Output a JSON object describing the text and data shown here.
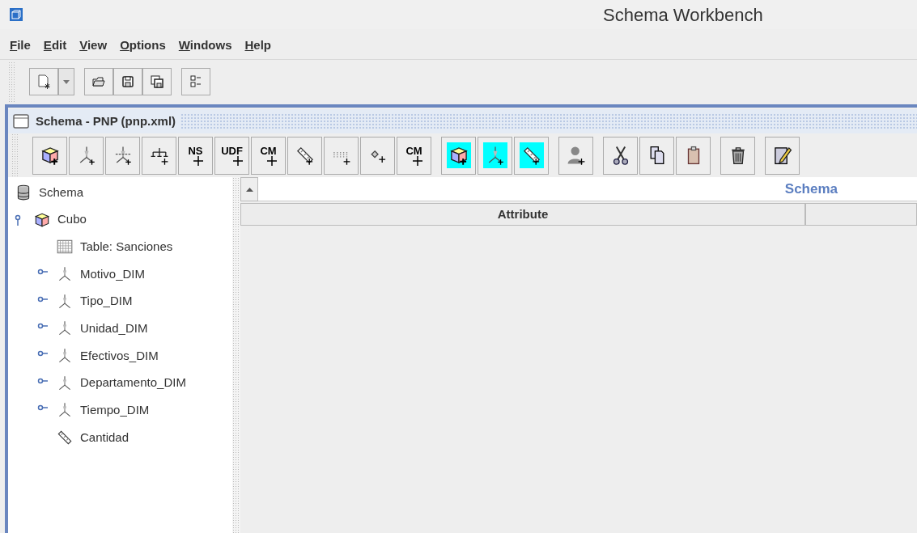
{
  "window": {
    "title": "Schema Workbench"
  },
  "menu": [
    {
      "label": "File"
    },
    {
      "label": "Edit"
    },
    {
      "label": "View"
    },
    {
      "label": "Options"
    },
    {
      "label": "Windows"
    },
    {
      "label": "Help"
    }
  ],
  "main_toolbar": [
    [
      {
        "kind": "new"
      },
      {
        "kind": "dropdown"
      }
    ],
    [
      {
        "kind": "open"
      },
      {
        "kind": "save"
      },
      {
        "kind": "save-all"
      }
    ],
    [
      {
        "kind": "prefs"
      }
    ]
  ],
  "schema_window": {
    "title": "Schema - PNP (pnp.xml)",
    "tool_groups": [
      [
        {
          "kind": "cube",
          "highlighted": false
        },
        {
          "kind": "dimension",
          "highlighted": false
        },
        {
          "kind": "dimension-usage",
          "highlighted": false
        },
        {
          "kind": "hierarchy",
          "highlighted": false
        },
        {
          "kind": "text",
          "label": "NS",
          "highlighted": false
        },
        {
          "kind": "text",
          "label": "UDF",
          "highlighted": false
        },
        {
          "kind": "text",
          "label": "CM",
          "highlighted": false
        },
        {
          "kind": "measure",
          "highlighted": false
        },
        {
          "kind": "levels",
          "highlighted": false
        },
        {
          "kind": "property",
          "highlighted": false
        },
        {
          "kind": "text-diamond",
          "label": "CM",
          "highlighted": false
        }
      ],
      [
        {
          "kind": "cube",
          "highlighted": true
        },
        {
          "kind": "dimension",
          "highlighted": true
        },
        {
          "kind": "measure",
          "highlighted": true
        }
      ],
      [
        {
          "kind": "role",
          "highlighted": false
        }
      ],
      [
        {
          "kind": "cut",
          "highlighted": false
        },
        {
          "kind": "copy",
          "highlighted": false
        },
        {
          "kind": "paste",
          "highlighted": false
        }
      ],
      [
        {
          "kind": "delete",
          "highlighted": false
        }
      ],
      [
        {
          "kind": "edit",
          "highlighted": false
        }
      ]
    ],
    "tree": {
      "label": "Schema",
      "kind": "schema",
      "children": [
        {
          "label": "Cubo",
          "kind": "cube",
          "expanded": true,
          "children": [
            {
              "label": "Table: Sanciones",
              "kind": "table"
            },
            {
              "label": "Motivo_DIM",
              "kind": "dimension",
              "expanded": false
            },
            {
              "label": "Tipo_DIM",
              "kind": "dimension",
              "expanded": false
            },
            {
              "label": "Unidad_DIM",
              "kind": "dimension",
              "expanded": false
            },
            {
              "label": "Efectivos_DIM",
              "kind": "dimension",
              "expanded": false
            },
            {
              "label": "Departamento_DIM",
              "kind": "dimension",
              "expanded": false
            },
            {
              "label": "Tiempo_DIM",
              "kind": "dimension",
              "expanded": false
            },
            {
              "label": "Cantidad",
              "kind": "measure"
            }
          ]
        }
      ]
    },
    "detail": {
      "title": "Schema",
      "columns": [
        "Attribute"
      ]
    }
  }
}
